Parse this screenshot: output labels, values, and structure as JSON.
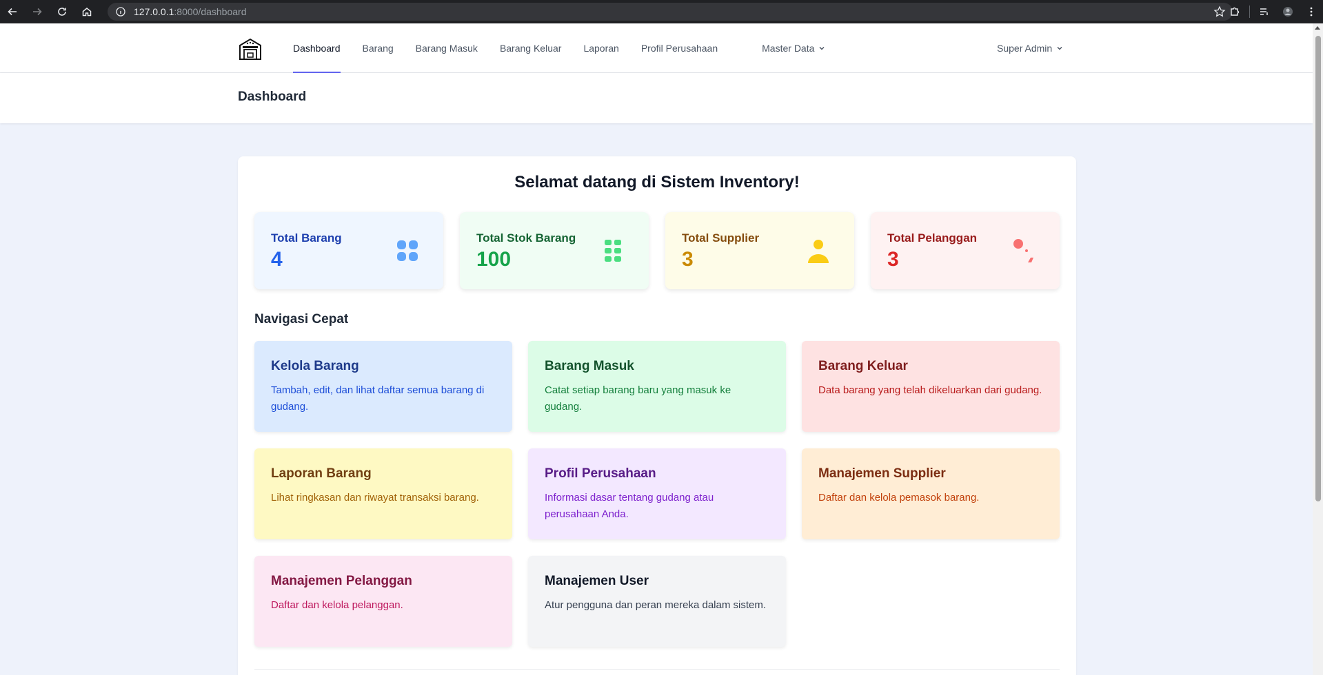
{
  "browser": {
    "url_host": "127.0.0.1",
    "url_path": ":8000/dashboard"
  },
  "nav": {
    "links": [
      {
        "label": "Dashboard",
        "active": true
      },
      {
        "label": "Barang"
      },
      {
        "label": "Barang Masuk"
      },
      {
        "label": "Barang Keluar"
      },
      {
        "label": "Laporan"
      },
      {
        "label": "Profil Perusahaan"
      },
      {
        "label": "Master Data"
      }
    ],
    "user": "Super Admin"
  },
  "page": {
    "title": "Dashboard",
    "welcome": "Selamat datang di Sistem Inventory!",
    "quick_nav_title": "Navigasi Cepat"
  },
  "stats": [
    {
      "label": "Total Barang",
      "value": "4",
      "icon": "grid-icon",
      "bg": "#eff6ff",
      "label_color": "#1e40af",
      "value_color": "#2563eb",
      "icon_color": "#60a5fa"
    },
    {
      "label": "Total Stok Barang",
      "value": "100",
      "icon": "apps-icon",
      "bg": "#f0fdf4",
      "label_color": "#166534",
      "value_color": "#16a34a",
      "icon_color": "#4ade80"
    },
    {
      "label": "Total Supplier",
      "value": "3",
      "icon": "user-icon",
      "bg": "#fefce8",
      "label_color": "#854d0e",
      "value_color": "#ca8a04",
      "icon_color": "#facc15"
    },
    {
      "label": "Total Pelanggan",
      "value": "3",
      "icon": "users-icon",
      "bg": "#fef2f2",
      "label_color": "#991b1b",
      "value_color": "#dc2626",
      "icon_color": "#f87171"
    }
  ],
  "quick_nav": [
    {
      "title": "Kelola Barang",
      "desc": "Tambah, edit, dan lihat daftar semua barang di gudang.",
      "bg": "#dbeafe",
      "title_color": "#1e3a8a",
      "desc_color": "#1d4ed8"
    },
    {
      "title": "Barang Masuk",
      "desc": "Catat setiap barang baru yang masuk ke gudang.",
      "bg": "#dcfce7",
      "title_color": "#14532d",
      "desc_color": "#15803d"
    },
    {
      "title": "Barang Keluar",
      "desc": "Data barang yang telah dikeluarkan dari gudang.",
      "bg": "#fee2e2",
      "title_color": "#7f1d1d",
      "desc_color": "#b91c1c"
    },
    {
      "title": "Laporan Barang",
      "desc": "Lihat ringkasan dan riwayat transaksi barang.",
      "bg": "#fef9c3",
      "title_color": "#713f12",
      "desc_color": "#a16207"
    },
    {
      "title": "Profil Perusahaan",
      "desc": "Informasi dasar tentang gudang atau perusahaan Anda.",
      "bg": "#f3e8ff",
      "title_color": "#581c87",
      "desc_color": "#7e22ce"
    },
    {
      "title": "Manajemen Supplier",
      "desc": "Daftar dan kelola pemasok barang.",
      "bg": "#ffedd5",
      "title_color": "#7c2d12",
      "desc_color": "#c2410c"
    },
    {
      "title": "Manajemen Pelanggan",
      "desc": "Daftar dan kelola pelanggan.",
      "bg": "#fce7f3",
      "title_color": "#831843",
      "desc_color": "#be185d"
    },
    {
      "title": "Manajemen User",
      "desc": "Atur pengguna dan peran mereka dalam sistem.",
      "bg": "#f3f4f6",
      "title_color": "#111827",
      "desc_color": "#374151"
    }
  ]
}
